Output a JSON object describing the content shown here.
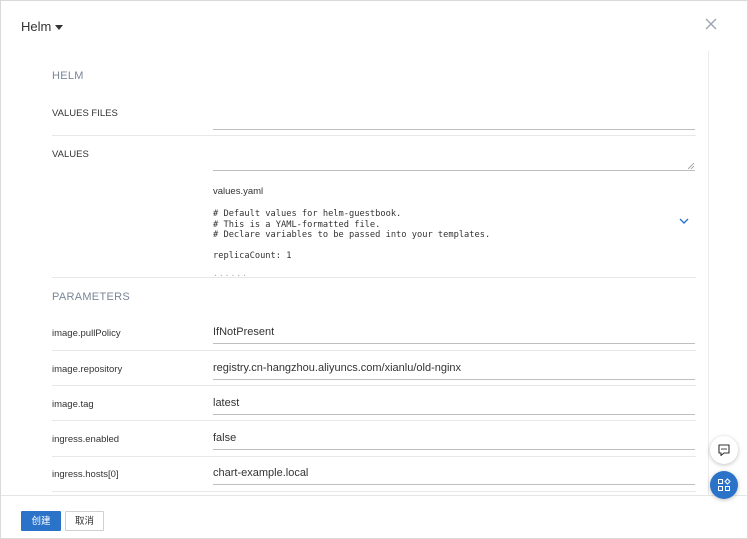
{
  "header": {
    "title": "Helm"
  },
  "helm_section": {
    "title": "HELM",
    "values_files_label": "VALUES FILES",
    "values_files_value": "",
    "values_label": "VALUES",
    "values_value": "",
    "file_name": "values.yaml",
    "code": "# Default values for helm-guestbook.\n# This is a YAML-formatted file.\n# Declare variables to be passed into your templates.\n\nreplicaCount: 1",
    "code_more": "......"
  },
  "parameters": {
    "title": "PARAMETERS",
    "rows": [
      {
        "label": "image.pullPolicy",
        "value": "IfNotPresent"
      },
      {
        "label": "image.repository",
        "value": "registry.cn-hangzhou.aliyuncs.com/xianlu/old-nginx"
      },
      {
        "label": "image.tag",
        "value": "latest"
      },
      {
        "label": "ingress.enabled",
        "value": "false"
      },
      {
        "label": "ingress.hosts[0]",
        "value": "chart-example.local"
      }
    ]
  },
  "footer": {
    "create_label": "创建",
    "cancel_label": "取消"
  },
  "colors": {
    "primary": "#2b73c9",
    "section_title": "#7a8797"
  }
}
